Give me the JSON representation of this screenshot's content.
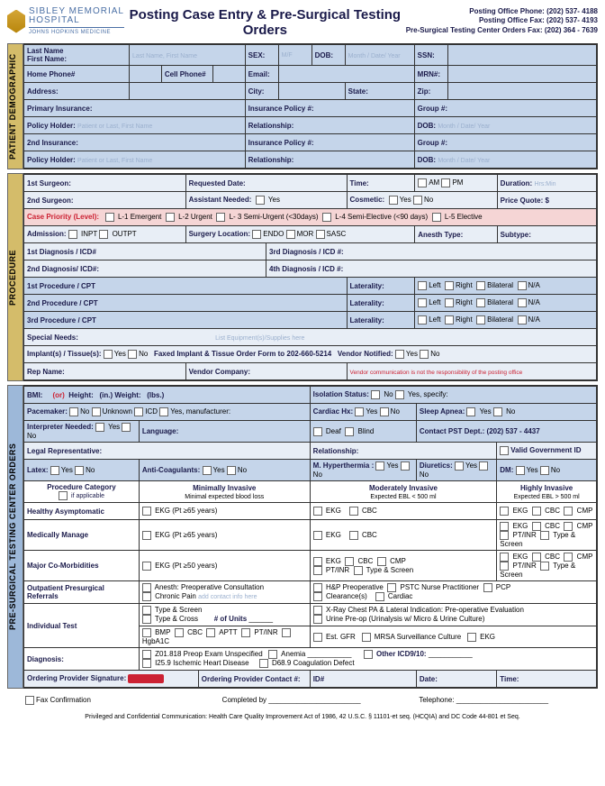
{
  "hospital": {
    "name": "SIBLEY MEMORIAL",
    "sub": "HOSPITAL",
    "tag": "JOHNS HOPKINS MEDICINE"
  },
  "title": "Posting Case Entry & Pre-Surgical Testing Orders",
  "contact": {
    "l1": "Posting Office Phone: (202) 537- 4188",
    "l2": "Posting Office Fax: (202) 537- 4193",
    "l3": "Pre-Surgical Testing Center Orders Fax: (202) 364 - 7639"
  },
  "tabs": {
    "demo": "PATIENT DEMOGRAPHIC",
    "proc": "PROCEDURE",
    "pst": "PRE-SURGICAL TESTING CENTER ORDERS"
  },
  "l": {
    "lastName": "Last Name",
    "firstName": "First Name:",
    "lastHint": "Last Name, First Name",
    "sex": "SEX:",
    "dob": "DOB:",
    "dobHint": "Month / Date/ Year",
    "ssn": "SSN:",
    "homePhone": "Home Phone#",
    "cellPhone": "Cell Phone#",
    "email": "Email:",
    "mrn": "MRN#:",
    "address": "Address:",
    "city": "City:",
    "state": "State:",
    "zip": "Zip:",
    "primIns": "Primary Insurance:",
    "insPol": "Insurance Policy #:",
    "group": "Group #:",
    "polHolder": "Policy Holder:",
    "polHint": "Patient or Last, First Name",
    "rel": "Relationship:",
    "dob2": "DOB:",
    "dobHint2": "Month / Date/ Year",
    "secIns": "2nd Insurance:",
    "surg1": "1st Surgeon:",
    "reqDate": "Requested Date:",
    "time": "Time:",
    "am": "AM",
    "pm": "PM",
    "duration": "Duration:",
    "durHint": "Hrs:Min",
    "surg2": "2nd Surgeon:",
    "assist": "Assistant Needed:",
    "yes": "Yes",
    "cosmetic": "Cosmetic:",
    "no": "No",
    "price": "Price Quote: $",
    "casePri": "Case Priority (Level):",
    "l1e": "L-1 Emergent",
    "l2u": "L-2 Urgent",
    "l3su": "L- 3 Semi-Urgent (<30days)",
    "l4se": "L-4 Semi-Elective (<90 days)",
    "l5e": "L-5 Elective",
    "admission": "Admission:",
    "inpt": "INPT",
    "outpt": "OUTPT",
    "surgLoc": "Surgery Location:",
    "endo": "ENDO",
    "mor": "MOR",
    "sasc": "SASC",
    "anesth": "Anesth Type:",
    "subtype": "Subtype:",
    "diag1": "1st Diagnosis / ICD#",
    "diag3": "3rd Diagnosis / ICD #:",
    "diag2": "2nd Diagnosis/ ICD#:",
    "diag4": "4th Diagnosis / ICD #:",
    "proc1": "1st Procedure / CPT",
    "lat": "Laterality:",
    "left": "Left",
    "right": "Right",
    "bilat": "Bilateral",
    "na": "N/A",
    "proc2": "2nd Procedure / CPT",
    "proc3": "3rd Procedure / CPT",
    "special": "Special Needs:",
    "specHint": "List Equipment(s)/Supplies here",
    "implant": "Implant(s) / Tissue(s):",
    "faxForm": "Faxed Implant & Tissue Order Form to 202-660-5214",
    "vendor": "Vendor Notified:",
    "rep": "Rep Name:",
    "vendComp": "Vendor Company:",
    "vendNote": "Vendor communication is not the responsibility of the posting office",
    "bmi": "BMI:",
    "or": "(or)",
    "height": "Height:",
    "in": "(in.)",
    "weight": "Weight:",
    "lbs": "(lbs.)",
    "iso": "Isolation Status:",
    "isoSpec": "Yes, specify:",
    "pace": "Pacemaker:",
    "unk": "Unknown",
    "icd": "ICD",
    "yesMfr": "Yes, manufacturer:",
    "cardiac": "Cardiac Hx:",
    "sleep": "Sleep Apnea:",
    "interp": "Interpreter Needed:",
    "lang": "Language:",
    "deaf": "Deaf",
    "blind": "Blind",
    "contact": "Contact PST Dept.: (202) 537 - 4437",
    "legal": "Legal Representative:",
    "validId": "Valid Government ID",
    "latex": "Latex:",
    "antico": "Anti-Coagulants:",
    "mhyper": "M. Hyperthermia :",
    "diur": "Diuretics:",
    "dm": "DM:",
    "procCat": "Procedure Category",
    "ifApp": "if applicable",
    "minInv": "Minimally Invasive",
    "minExp": "Minimal expected blood loss",
    "modInv": "Moderately Invasive",
    "modExp": "Expected EBL < 500 ml",
    "highInv": "Highly Invasive",
    "highExp": "Expected EBL > 500 ml",
    "healthy": "Healthy Asymptomatic",
    "ekg65": "EKG (Pt ≥65 years)",
    "ekg": "EKG",
    "cbc": "CBC",
    "cmp": "CMP",
    "medMan": "Medically Manage",
    "ptinr": "PT/INR",
    "typeScr": "Type & Screen",
    "majorCo": "Major Co-Morbidities",
    "ekg50": "EKG (Pt ≥50 years)",
    "outpat": "Outpatient Presurgical Referrals",
    "anesthCons": "Anesth: Preoperative Consultation",
    "chronic": "Chronic Pain",
    "chronicHint": "add contact info here",
    "hpPre": "H&P Preoperative",
    "pstc": "PSTC Nurse Practitioner",
    "pcp": "PCP",
    "clear": "Clearance(s)",
    "card": "Cardiac",
    "indTest": "Individual Test",
    "typeScreen": "Type & Screen",
    "typeCross": "Type & Cross",
    "units": "# of Units",
    "bmp": "BMP",
    "aptt": "APTT",
    "hba1c": "HgbA1C",
    "xray": "X-Ray Chest PA & Lateral   Indication:  Pre-operative Evaluation",
    "urine": "Urine Pre-op (Urinalysis w/ Micro & Urine Culture)",
    "gfr": "Est. GFR",
    "mrsa": "MRSA Surveillance Culture",
    "diagnosis": "Diagnosis:",
    "z01": "Z01.818 Preop Exam Unspecified",
    "anemia": "Anemia",
    "otherIcd": "Other ICD9/10:",
    "i25": "I25.9 Ischemic Heart Disease",
    "d68": "D68.9 Coagulation Defect",
    "ordProv": "Ordering Provider Signature:",
    "ordCont": "Ordering Provider Contact #:",
    "id": "ID#",
    "date": "Date:",
    "time2": "Time:",
    "faxConf": "Fax Confirmation",
    "compBy": "Completed by",
    "tel": "Telephone:"
  },
  "footer": "Privileged and Confidential Communication: Health Care Quality Improvement Act of 1986, 42 U.S.C. § 11101-et seq. (HCQIA) and DC Code 44-801 et Seq."
}
